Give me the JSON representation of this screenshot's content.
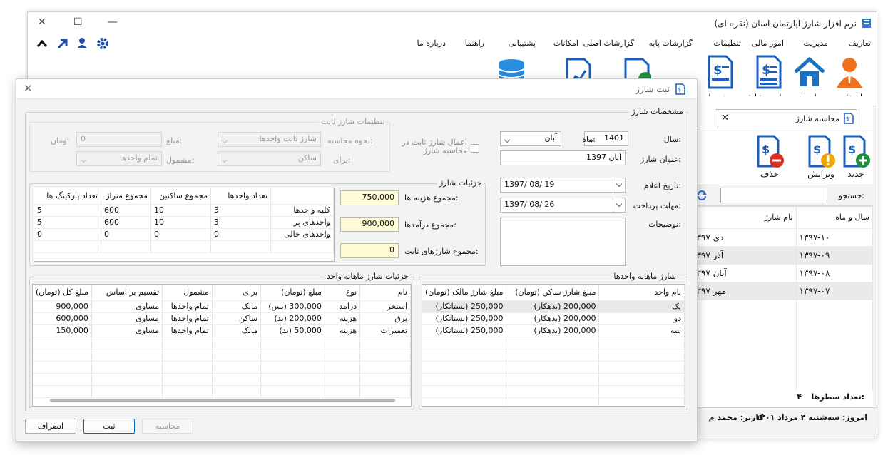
{
  "main": {
    "title": "نرم افزار شارژ آپارتمان آسان (نقره ای)",
    "menus": [
      "تعاریف",
      "مدیریت",
      "امور مالی",
      "تنظیمات",
      "گزارشات پایه",
      "گزارشات اصلی",
      "امکانات",
      "پشتیبانی",
      "راهنما",
      "درباره ما"
    ],
    "ribbon": [
      "اشخاص",
      "واحدها",
      "محاسبه شارژ",
      "صورتحساب"
    ],
    "side_tab": "محاسبه شارژ",
    "side_buttons": {
      "new": "جدید",
      "edit": "ویرایش",
      "delete": "حذف"
    },
    "search_label": "جستجو:",
    "side_cols": [
      "نام شارژ",
      "سال و ماه"
    ],
    "side_rows": [
      [
        "دی ۱۳۹۷",
        "۱۳۹۷-۱۰"
      ],
      [
        "آذر ۱۳۹۷",
        "۱۳۹۷-۰۹"
      ],
      [
        "آبان ۱۳۹۷",
        "۱۳۹۷-۰۸"
      ],
      [
        "مهر ۱۳۹۷",
        "۱۳۹۷-۰۷"
      ]
    ],
    "row_count_label": "تعداد سطرها:",
    "row_count": "۴",
    "status_date": "امروز: سه‌شنبه ۴ مرداد ۱۴۰۱",
    "status_user": "کاربر: محمد م"
  },
  "dialog": {
    "title": "ثبت شارژ",
    "spec_title": "مشخصات شارژ",
    "year_label": "سال:",
    "year": "1401",
    "month_label": "ماه:",
    "month": "آبان",
    "title_label": "عنوان شارژ:",
    "title_value": "آبان 1397",
    "announce_label": "تاریخ اعلام:",
    "announce_date": "1397/ 08/ 19",
    "deadline_label": "مهلت پرداخت:",
    "deadline_date": "1397/ 08/ 26",
    "desc_label": "توضیحات:",
    "apply_fixed": "اعمال شارژ ثابت در محاسبه شارژ",
    "fixed_title": "تنظیمات شارژ ثابت",
    "calc_method_label": "نحوه محاسبه:",
    "calc_method": "شارژ ثابت واحدها",
    "amount_label": "مبلغ:",
    "amount": "0",
    "amount_unit": "تومان",
    "for_label": "برای:",
    "for_value": "ساکن",
    "include_label": "مشمول:",
    "include_value": "تمام واحدها",
    "details_title": "جزئیات شارژ",
    "total_cost_label": "مجموع هزینه ها:",
    "total_cost": "750,000",
    "total_income_label": "مجموع درآمدها:",
    "total_income": "900,000",
    "total_fixed_label": "مجموع شارژهای ثابت:",
    "total_fixed": "0",
    "summary_cols": [
      "",
      "تعداد واحدها",
      "مجموع ساکنین",
      "مجموع متراژ",
      "تعداد پارکینگ ها"
    ],
    "summary_rows": [
      [
        "کلیه واحدها",
        "3",
        "10",
        "600",
        "5"
      ],
      [
        "واحدهای پر",
        "3",
        "10",
        "600",
        "5"
      ],
      [
        "واحدهای خالی",
        "0",
        "0",
        "0",
        "0"
      ]
    ],
    "monthly_title": "شارژ ماهانه واحدها",
    "monthly_cols": [
      "نام واحد",
      "مبلغ شارژ ساکن (تومان)",
      "مبلغ شارژ مالک (تومان)"
    ],
    "monthly_rows": [
      [
        "یک",
        "200,000 (بدهکار)",
        "250,000 (بستانکار)"
      ],
      [
        "دو",
        "200,000 (بدهکار)",
        "250,000 (بستانکار)"
      ],
      [
        "سه",
        "200,000 (بدهکار)",
        "250,000 (بستانکار)"
      ]
    ],
    "unit_details_title": "جزئیات شارژ ماهانه واحد",
    "detail_cols": [
      "نام",
      "نوع",
      "مبلغ (تومان)",
      "برای",
      "مشمول",
      "تقسیم بر اساس",
      "مبلغ کل (تومان)"
    ],
    "detail_rows": [
      [
        "استخر",
        "درآمد",
        "300,000 (بس)",
        "مالک",
        "تمام واحدها",
        "مساوی",
        "900,000"
      ],
      [
        "برق",
        "هزینه",
        "200,000 (بد)",
        "ساکن",
        "تمام واحدها",
        "مساوی",
        "600,000"
      ],
      [
        "تعمیرات",
        "هزینه",
        "50,000 (بد)",
        "مالک",
        "تمام واحدها",
        "مساوی",
        "150,000"
      ]
    ],
    "btn_cancel": "انصراف",
    "btn_save": "ثبت",
    "btn_calc": "محاسبه"
  },
  "colors": {
    "accent": "#2a6cd4",
    "selection": "#e8e8e8",
    "input_yellow": "#fffbd6"
  }
}
